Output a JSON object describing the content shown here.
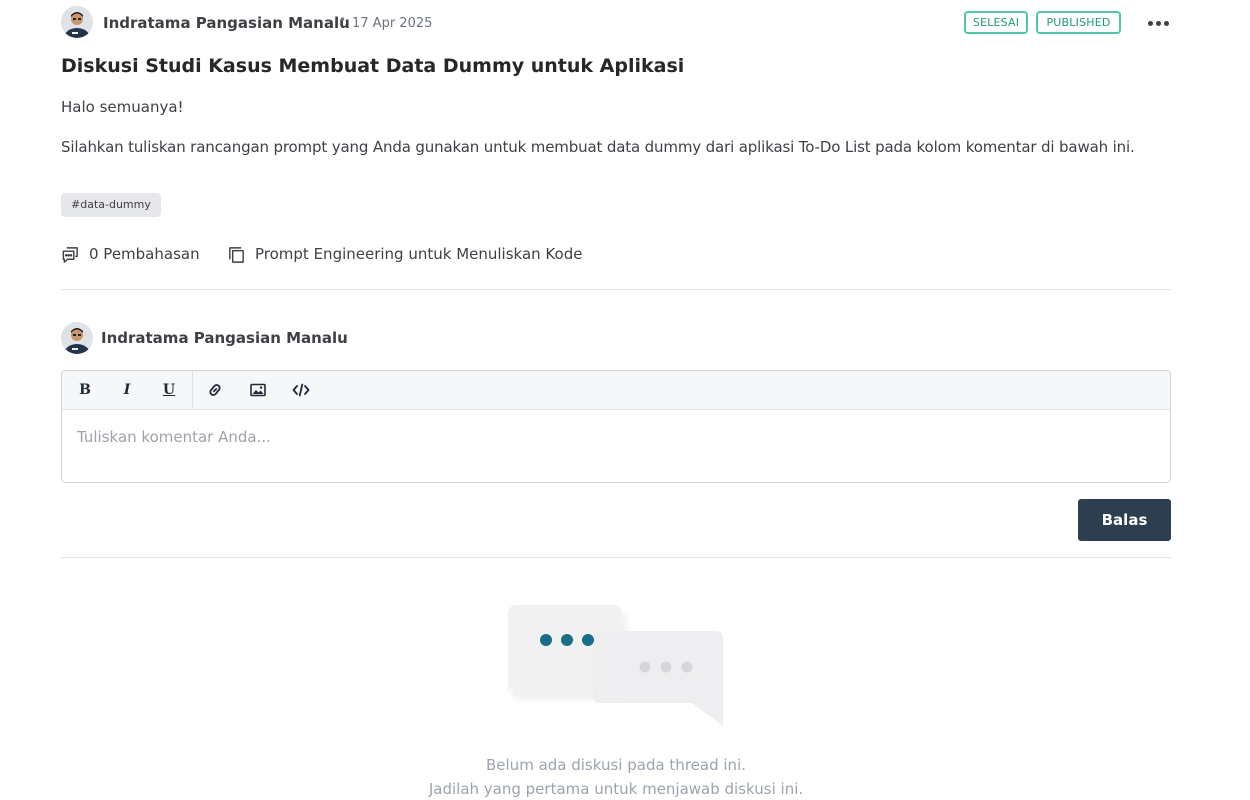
{
  "post": {
    "author": "Indratama Pangasian Manalu",
    "separator": "•",
    "date": "17 Apr 2025",
    "badges": {
      "status": "SELESAI",
      "publish": "PUBLISHED"
    },
    "title": "Diskusi Studi Kasus Membuat Data Dummy untuk Aplikasi",
    "paragraphs": [
      "Halo semuanya!",
      "Silahkan tuliskan rancangan prompt yang Anda gunakan untuk membuat data dummy dari aplikasi To-Do List pada kolom komentar di bawah ini."
    ],
    "tag": "#data-dummy",
    "discussion_count": "0 Pembahasan",
    "course": "Prompt Engineering untuk Menuliskan Kode"
  },
  "comment": {
    "user": "Indratama Pangasian Manalu",
    "toolbar": {
      "bold": "B",
      "italic": "I",
      "underline": "U"
    },
    "placeholder": "Tuliskan komentar Anda...",
    "submit_label": "Balas"
  },
  "empty_state": {
    "line1": "Belum ada diskusi pada thread ini.",
    "line2": "Jadilah yang pertama untuk menjawab diskusi ini."
  },
  "colors": {
    "badge_border": "#4fc7a6",
    "badge_text": "#1f9b7a",
    "button_bg": "#2d3e50",
    "accent_dots": "#1a6f86"
  }
}
